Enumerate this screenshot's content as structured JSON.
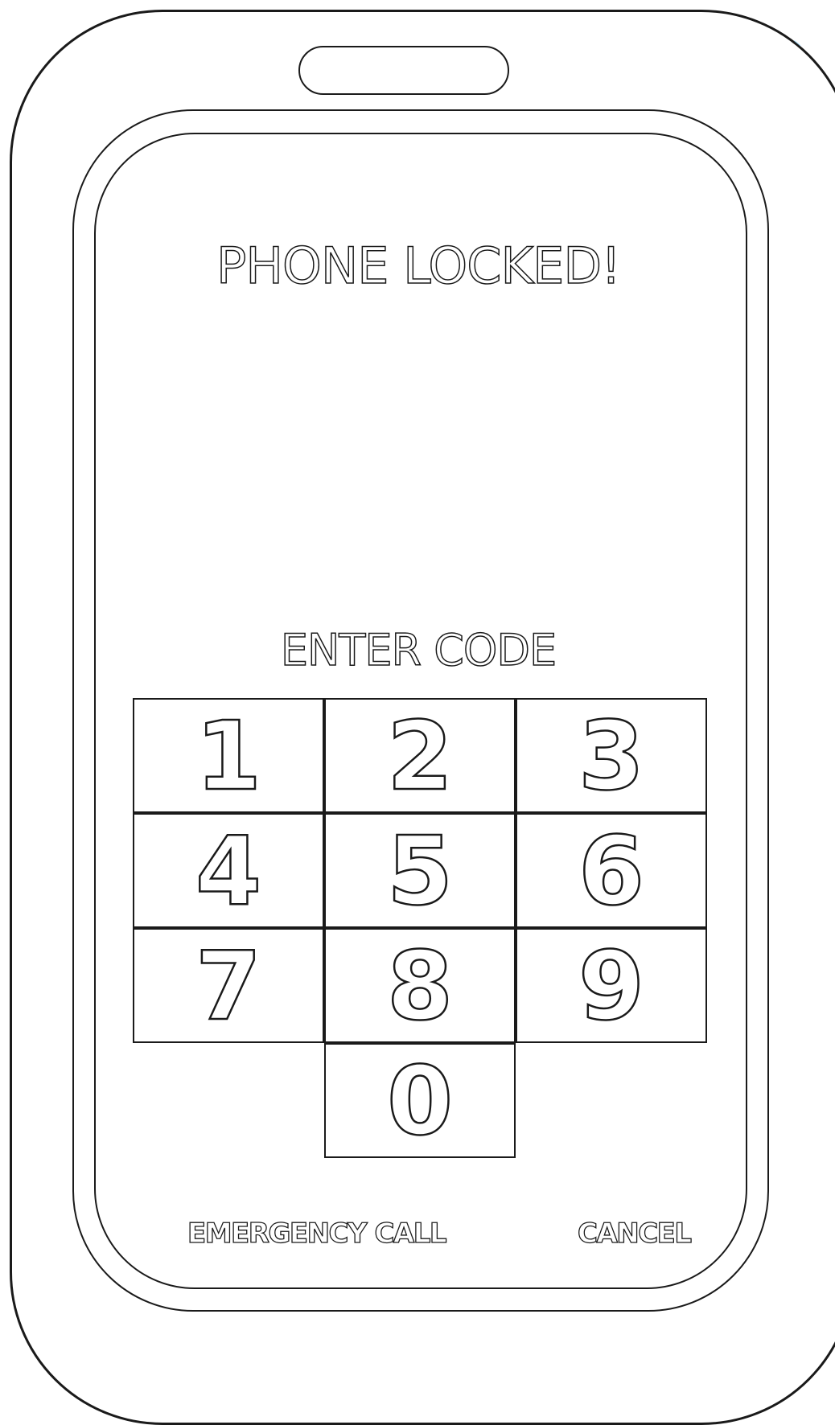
{
  "screen": {
    "title": "PHONE LOCKED!",
    "prompt": "ENTER CODE"
  },
  "keypad": {
    "keys": [
      "1",
      "2",
      "3",
      "4",
      "5",
      "6",
      "7",
      "8",
      "9",
      "0"
    ]
  },
  "actions": {
    "emergency_label": "EMERGENCY CALL",
    "cancel_label": "CANCEL"
  },
  "colors": {
    "outline": "#1a1a1a",
    "background": "#ffffff"
  }
}
